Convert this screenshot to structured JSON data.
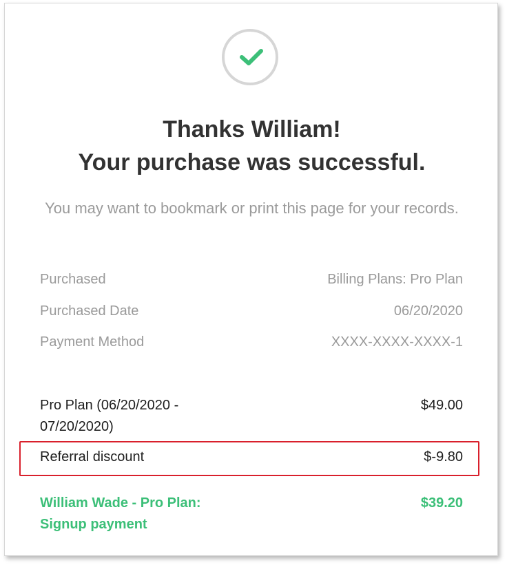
{
  "header": {
    "title_line1": "Thanks William!",
    "title_line2": "Your purchase was successful.",
    "subtitle": "You may want to bookmark or print this page for your records.",
    "success_icon": "checkmark-icon",
    "accent_color": "#3cbf78"
  },
  "details": [
    {
      "label": "Purchased",
      "value": "Billing Plans: Pro Plan"
    },
    {
      "label": "Purchased Date",
      "value": "06/20/2020"
    },
    {
      "label": "Payment Method",
      "value": "XXXX-XXXX-XXXX-1"
    }
  ],
  "line_items": [
    {
      "label": "Pro Plan (06/20/2020 - 07/20/2020)",
      "amount": "$49.00"
    },
    {
      "label": "Referral discount",
      "amount": "$-9.80",
      "highlighted": true
    }
  ],
  "total": {
    "label": "William Wade - Pro Plan: Signup payment",
    "amount": "$39.20"
  },
  "highlight_color": "#d9202c"
}
